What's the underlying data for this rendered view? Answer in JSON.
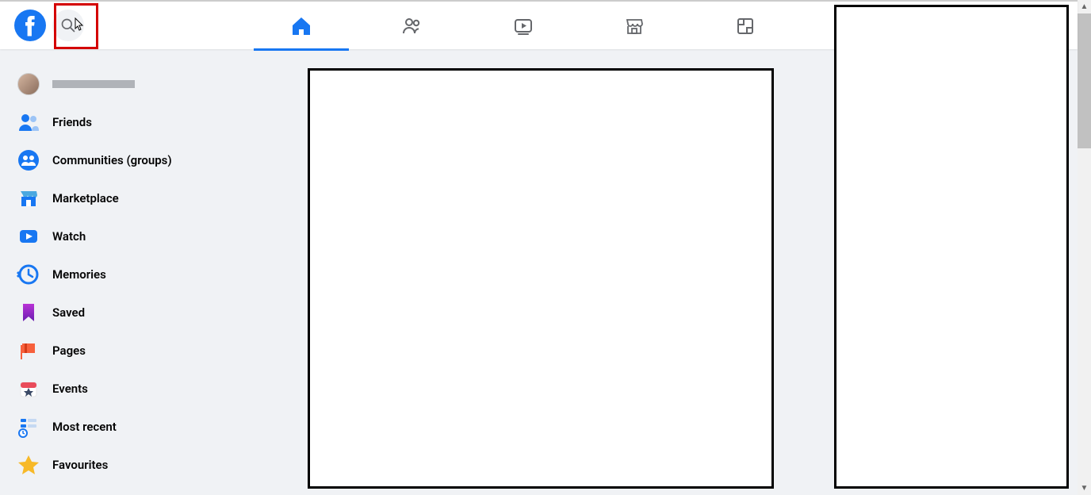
{
  "sidebar": {
    "user_name_placeholder": "",
    "items": [
      {
        "label": "Friends"
      },
      {
        "label": "Communities (groups)"
      },
      {
        "label": "Marketplace"
      },
      {
        "label": "Watch"
      },
      {
        "label": "Memories"
      },
      {
        "label": "Saved"
      },
      {
        "label": "Pages"
      },
      {
        "label": "Events"
      },
      {
        "label": "Most recent"
      },
      {
        "label": "Favourites"
      }
    ]
  },
  "nav": {
    "home": "Home",
    "friends": "Friends",
    "watch": "Watch",
    "marketplace": "Marketplace",
    "gaming": "Gaming"
  },
  "colors": {
    "brand": "#1877f2",
    "icon_inactive": "#65676b",
    "highlight": "#d40000"
  }
}
